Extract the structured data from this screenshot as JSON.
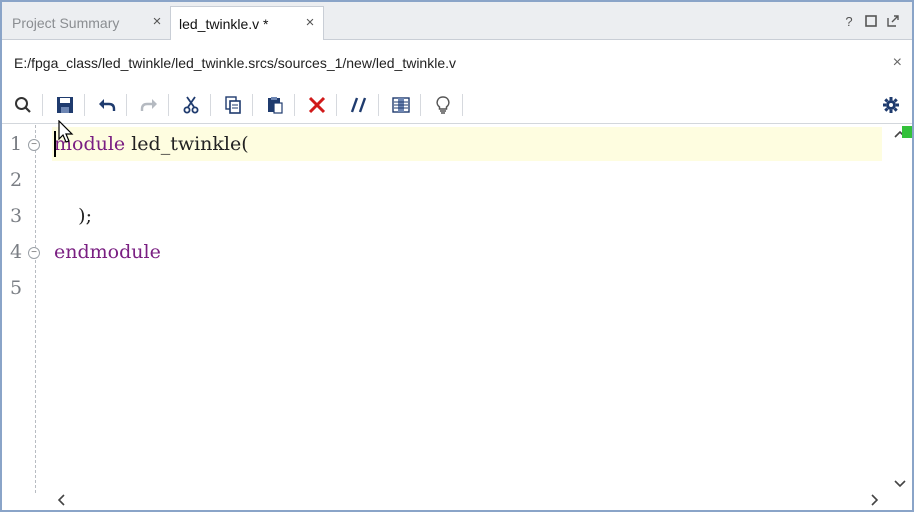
{
  "tabs": [
    {
      "label": "Project Summary",
      "active": false
    },
    {
      "label": "led_twinkle.v *",
      "active": true
    }
  ],
  "tab_controls": {
    "help": "?",
    "restore": "□",
    "float": "⇱"
  },
  "path": "E:/fpga_class/led_twinkle/led_twinkle.srcs/sources_1/new/led_twinkle.v",
  "toolbar_icons": [
    "search-icon",
    "save-icon",
    "undo-icon",
    "redo-icon",
    "cut-icon",
    "copy-icon",
    "paste-icon",
    "delete-icon",
    "comment-icon",
    "column-select-icon",
    "lightbulb-icon",
    "settings-gear-icon"
  ],
  "editor": {
    "lines": [
      {
        "number": "1",
        "keyword": "module",
        "text": " led_twinkle("
      },
      {
        "number": "2",
        "keyword": "",
        "text": ""
      },
      {
        "number": "3",
        "keyword": "",
        "text": "    );"
      },
      {
        "number": "4",
        "keyword": "endmodule",
        "text": ""
      },
      {
        "number": "5",
        "keyword": "",
        "text": ""
      }
    ]
  },
  "colors": {
    "keyword": "#7a1f82",
    "current_line": "#fefde0",
    "frame_border": "#8aa4c8",
    "delete_red": "#d11a1a",
    "status_green": "#33c13a"
  }
}
